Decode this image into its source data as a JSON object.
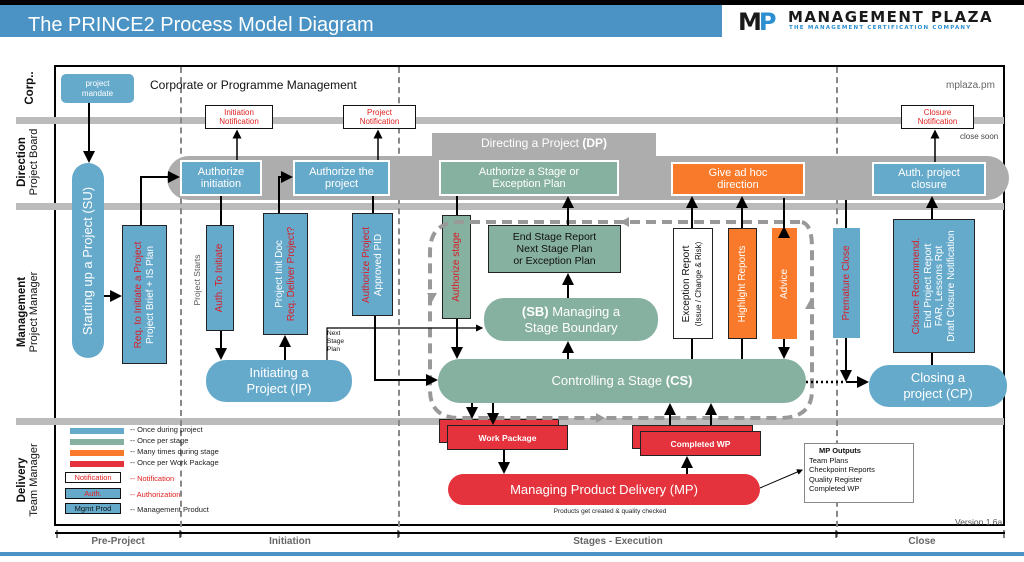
{
  "header": {
    "title": "The PRINCE2 Process Model Diagram",
    "logo_mark": "MP",
    "logo_name": "MANAGEMENT PLAZA",
    "logo_tagline": "THE MANAGEMENT CERTIFICATION COMPANY"
  },
  "lanes": [
    {
      "title": "Corp..",
      "subtitle": ""
    },
    {
      "title": "Direction",
      "subtitle": "Project Board"
    },
    {
      "title": "Management",
      "subtitle": "Project Manager"
    },
    {
      "title": "Delivery",
      "subtitle": "Team Manager"
    }
  ],
  "corporate": {
    "label": "Corporate or Programme Management",
    "site": "mplaza.pm",
    "mandate": "project mandate"
  },
  "notifications": {
    "initiation": "Initiation Notification",
    "project": "Project Notification",
    "closure": "Closure Notification",
    "close_soon": "close soon"
  },
  "direction": {
    "title_prefix": "Directing a Project ",
    "title_abbr": "(DP)",
    "authorize_initiation": "Authorize initiation",
    "authorize_project": "Authorize the project",
    "authorize_stage": "Authorize a Stage or Exception Plan",
    "ad_hoc": "Give ad hoc direction",
    "auth_closure": "Auth. project closure"
  },
  "processes": {
    "su": "Starting up a Project (SU)",
    "ip_line1": "Initiating a",
    "ip_line2": "Project (IP)",
    "sb_abbr": "(SB)",
    "sb_line1": " Managing a",
    "sb_line2": "Stage Boundary",
    "cs_prefix": "Controlling a Stage ",
    "cs_abbr": "(CS)",
    "cp_line1": "Closing a",
    "cp_line2": "project (CP)",
    "mp": "Managing Product Delivery (MP)",
    "mp_note": "Products get created & quality checked"
  },
  "products": {
    "req_initiate_red": "Req. to Initiate a Project",
    "req_initiate_black": "Project Brief + IS Plan",
    "project_starts": "Project  Starts",
    "auth_to_initiate": "Auth. To Initiate",
    "pid_black": "Project  Init  Doc",
    "pid_red": "Req. Deliver Project?",
    "authorize_project_red": "Authorize Project",
    "approved_pid": "Approved PID",
    "next_stage_plan": "Next Stage Plan",
    "authorize_stage": "Authorize  stage",
    "end_stage_report": [
      "End Stage Report",
      "Next Stage Plan",
      "or Exception Plan"
    ],
    "exception_report": "Exception Report",
    "exception_sub": "(Issue / Change & Risk)",
    "highlight_reports": "Highlight Reports",
    "advice": "Advice",
    "premature_close": "Premature Close",
    "closure_red": "Closure Recommend.",
    "closure_lines": [
      "End Project Report",
      "FAR, Lessons Rpt",
      "Draft Closure Notification"
    ],
    "work_package": "Work Package",
    "completed_wp": "Completed WP"
  },
  "mp_outputs": {
    "title": "MP Outputs",
    "items": [
      "Team Plans",
      "Checkpoint Reports",
      "Quality Register",
      "Completed WP"
    ]
  },
  "legend": {
    "colors": [
      {
        "color": "#66aacb",
        "label": "-- Once during project"
      },
      {
        "color": "#86b0a0",
        "label": "-- Once per stage"
      },
      {
        "color": "#f97a2a",
        "label": "-- Many times during stage"
      },
      {
        "color": "#e4333d",
        "label": "-- Once per Work Package"
      }
    ],
    "notification_box": "Notification",
    "notification_label": "-- Notification",
    "auth_box": "Auth.",
    "auth_label": "-- Authorization",
    "mgmt_box": "Mgmt Prod",
    "mgmt_label": "-- Management Product"
  },
  "version": "Version 1.6a",
  "phases": [
    "Pre-Project",
    "Initiation",
    "Stages - Execution",
    "Close"
  ]
}
